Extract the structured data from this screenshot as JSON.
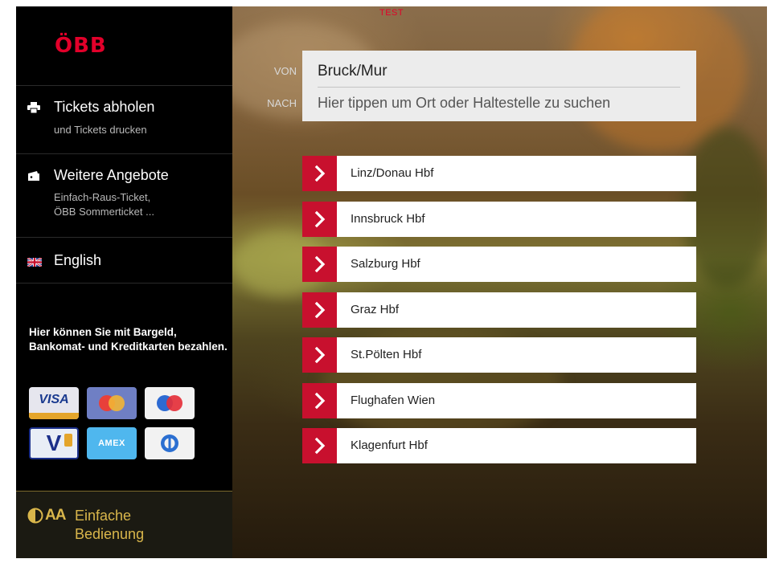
{
  "sidebar": {
    "logo": "ÖBB",
    "menu": [
      {
        "title": "Tickets abholen",
        "subtitle_lines": [
          "und Tickets drucken"
        ],
        "icon": "printer-icon"
      },
      {
        "title": "Weitere Angebote",
        "subtitle_lines": [
          "Einfach-Raus-Ticket,",
          "ÖBB Sommerticket ..."
        ],
        "icon": "ticket-icon"
      },
      {
        "title": "English",
        "subtitle_lines": [],
        "icon": "uk-flag-icon"
      }
    ],
    "payment_info": "Hier können Sie mit Bargeld, Bankomat- und Kreditkarten bezahlen.",
    "cards": [
      {
        "name": "VISA",
        "icon": "visa-card-icon"
      },
      {
        "name": "",
        "icon": "mastercard-icon"
      },
      {
        "name": "",
        "icon": "maestro-icon"
      },
      {
        "name": "V",
        "icon": "vpay-icon"
      },
      {
        "name": "AMEX",
        "icon": "amex-icon"
      },
      {
        "name": "",
        "icon": "diners-club-icon"
      }
    ],
    "easy_mode": {
      "label_line1": "Einfache",
      "label_line2": "Bedienung",
      "icon": "contrast-text-size-icon",
      "icon_text": "AA"
    }
  },
  "main": {
    "test_label": "TEST",
    "from_label": "VON",
    "to_label": "NACH",
    "from_value": "Bruck/Mur",
    "to_placeholder": "Hier tippen um Ort oder Haltestelle zu suchen",
    "destinations": [
      "Linz/Donau Hbf",
      "Innsbruck Hbf",
      "Salzburg Hbf",
      "Graz Hbf",
      "St.Pölten Hbf",
      "Flughafen Wien",
      "Klagenfurt Hbf"
    ]
  },
  "colors": {
    "brand_red": "#e2002a",
    "arrow_red": "#c8102e",
    "easy_gold": "#d9b64b"
  }
}
